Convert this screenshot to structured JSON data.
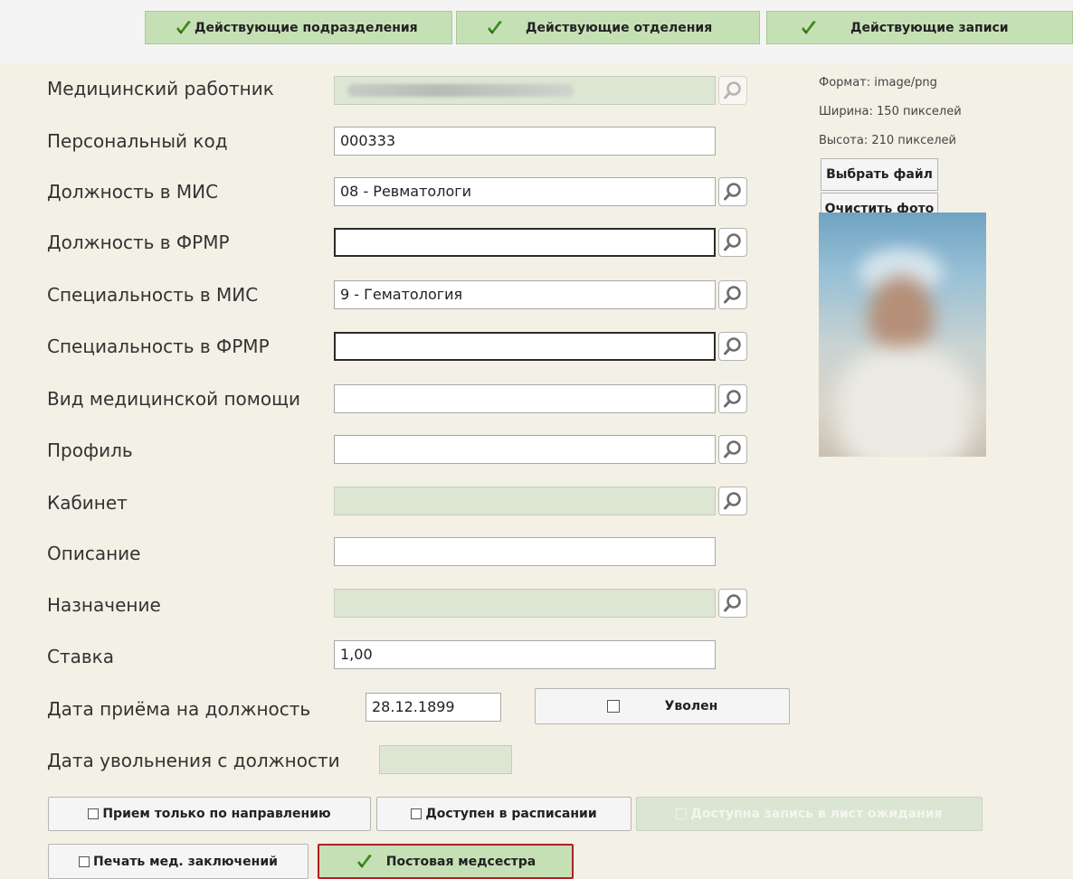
{
  "top_tabs": {
    "subdivisions": "Действующие подразделения",
    "departments": "Действующие отделения",
    "records": "Действующие записи"
  },
  "form": {
    "medical_worker": {
      "label": "Медицинский работник",
      "value": ""
    },
    "personal_code": {
      "label": "Персональный код",
      "value": "000333"
    },
    "position_mis": {
      "label": "Должность в МИС",
      "value": "08 - Ревматологи"
    },
    "position_frmr": {
      "label": "Должность в ФРМР",
      "value": ""
    },
    "specialty_mis": {
      "label": "Специальность в МИС",
      "value": "9 - Гематология"
    },
    "specialty_frmr": {
      "label": "Специальность в ФРМР",
      "value": ""
    },
    "care_type": {
      "label": "Вид медицинской помощи",
      "value": ""
    },
    "profile": {
      "label": "Профиль",
      "value": ""
    },
    "cabinet": {
      "label": "Кабинет",
      "value": ""
    },
    "description": {
      "label": "Описание",
      "value": ""
    },
    "purpose": {
      "label": "Назначение",
      "value": ""
    },
    "rate": {
      "label": "Ставка",
      "value": "1,00"
    },
    "hire_date": {
      "label": "Дата приёма на должность",
      "value": "28.12.1899"
    },
    "fired_label": "Уволен",
    "dismissal_date": {
      "label": "Дата увольнения с должности",
      "value": ""
    }
  },
  "photo_panel": {
    "format": "Формат: image/png",
    "width": "Ширина: 150 пикселей",
    "height": "Высота: 210 пикселей",
    "choose_file": "Выбрать файл",
    "clear_photo": "Очистить фото"
  },
  "options": {
    "referral_only": "Прием только по направлению",
    "available_schedule": "Доступен в расписании",
    "waiting_list": "Доступна запись в лист ожидания",
    "print_conclusions": "Печать мед. заключений",
    "ward_nurse": "Постовая медсестра"
  },
  "colors": {
    "background": "#f3f0e5",
    "tab_green": "#c6e0b5",
    "check_green": "#3e8a1f",
    "disabled_field": "#dde5d3",
    "highlight_border": "#b01f24"
  }
}
